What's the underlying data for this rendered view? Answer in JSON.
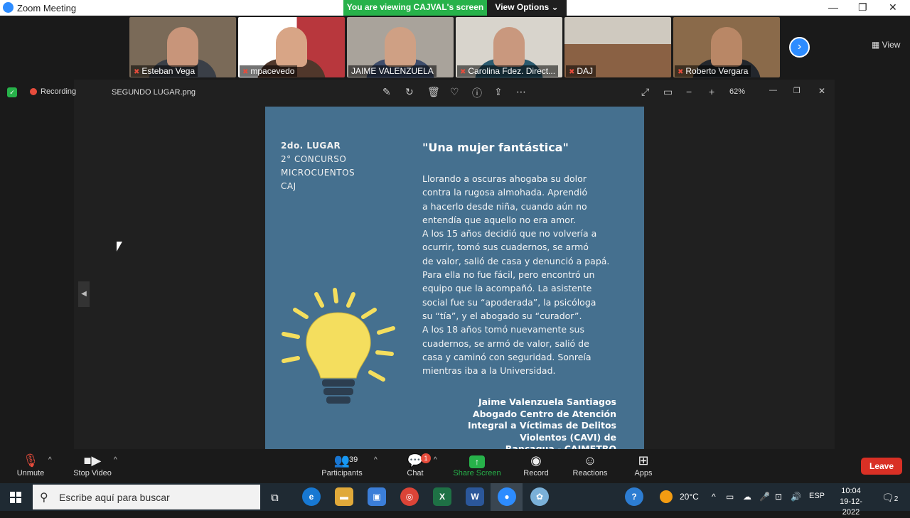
{
  "window": {
    "title": "Zoom Meeting",
    "share_banner": "You are viewing CAJVAL's screen",
    "view_options": "View Options ⌄"
  },
  "gallery": {
    "participants": [
      {
        "name": "Esteban Vega",
        "bg": "#7a6a58"
      },
      {
        "name": "mpacevedo",
        "bg": "#b8373d"
      },
      {
        "name": "JAIME VALENZUELA",
        "bg": "#a9a39b"
      },
      {
        "name": "Carolina Fdez. Direct...",
        "bg": "#d8d4cc"
      },
      {
        "name": "DAJ",
        "bg": "#6b5c4f"
      },
      {
        "name": "Roberto Vergara",
        "bg": "#8a6a4a"
      }
    ],
    "next_icon": "›",
    "view_label": "View"
  },
  "shared_window": {
    "recording_label": "Recording",
    "file_name": "SEGUNDO LUGAR.png",
    "zoom_level": "62%"
  },
  "card": {
    "tag_line1": "2do. LUGAR",
    "tag_line2": "2° CONCURSO",
    "tag_line3": "MICROCUENTOS",
    "tag_line4": "CAJ",
    "title": "\"Una mujer fantástica\"",
    "text_lines": [
      "Llorando a oscuras ahogaba su dolor",
      "contra la rugosa almohada. Aprendió",
      "a hacerlo desde niña, cuando aún no",
      "entendía que aquello no era amor.",
      "A los 15 años decidió que no volvería a",
      "ocurrir, tomó sus cuadernos, se armó",
      "de valor, salió de casa y denunció a papá.",
      "Para ella no fue fácil, pero encontró un",
      "equipo que la acompañó. La asistente",
      "social fue su “apoderada”, la psicóloga",
      "su “tía”, y el abogado su “curador”.",
      "A los 18 años tomó nuevamente sus",
      "cuadernos, se armó de valor, salió de",
      "casa y caminó con seguridad. Sonreía",
      "mientras iba a la Universidad."
    ],
    "sign_lines": [
      "Jaime Valenzuela Santiagos",
      "Abogado Centro de Atención",
      "Integral a Víctimas de Delitos",
      "Violentos (CAVI) de",
      "Rancagua - CAIMETRO"
    ],
    "bg_color": "#45708f",
    "bulb_color": "#f4de5e"
  },
  "controls": {
    "unmute": "Unmute",
    "stop_video": "Stop Video",
    "participants": "Participants",
    "participants_count": "39",
    "chat": "Chat",
    "chat_badge": "1",
    "share_screen": "Share Screen",
    "record": "Record",
    "reactions": "Reactions",
    "apps": "Apps",
    "leave": "Leave"
  },
  "taskbar": {
    "search_placeholder": "Escribe aquí para buscar",
    "temperature": "20°C",
    "language": "ESP",
    "time": "10:04",
    "date": "19-12-2022",
    "notifications": "2"
  }
}
